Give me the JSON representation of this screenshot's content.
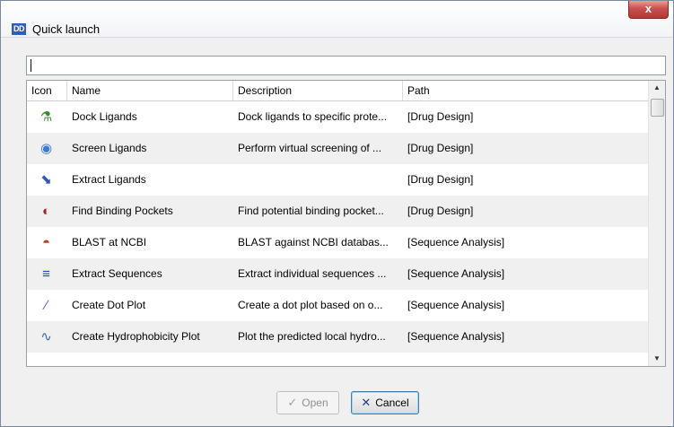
{
  "window": {
    "title": "Quick launch",
    "app_badge": "DD",
    "close_label": "x"
  },
  "search": {
    "value": "",
    "placeholder": ""
  },
  "table": {
    "headers": {
      "icon": "Icon",
      "name": "Name",
      "description": "Description",
      "path": "Path"
    },
    "rows": [
      {
        "icon": "dock-ligands-icon",
        "glyph": "⚗",
        "color": "#3a8a2a",
        "name": "Dock Ligands",
        "description": "Dock ligands to specific prote...",
        "path": "[Drug Design]"
      },
      {
        "icon": "screen-ligands-icon",
        "glyph": "◉",
        "color": "#3a7ad0",
        "name": "Screen Ligands",
        "description": "Perform virtual screening of ...",
        "path": "[Drug Design]"
      },
      {
        "icon": "extract-ligands-icon",
        "glyph": "⬊",
        "color": "#2d56b8",
        "name": "Extract Ligands",
        "description": "",
        "path": "[Drug Design]"
      },
      {
        "icon": "binding-pockets-icon",
        "glyph": "◐",
        "color": "#a0282e",
        "name": "Find Binding Pockets",
        "description": "Find potential binding pocket...",
        "path": "[Drug Design]"
      },
      {
        "icon": "blast-icon",
        "glyph": "◓",
        "color": "#c0392b",
        "name": "BLAST at NCBI",
        "description": "BLAST against NCBI databas...",
        "path": "[Sequence Analysis]"
      },
      {
        "icon": "extract-sequences-icon",
        "glyph": "≡",
        "color": "#1f4fa8",
        "name": "Extract Sequences",
        "description": "Extract individual sequences ...",
        "path": "[Sequence Analysis]"
      },
      {
        "icon": "dot-plot-icon",
        "glyph": "∕",
        "color": "#5060c8",
        "name": "Create Dot Plot",
        "description": "Create a dot plot based on o...",
        "path": "[Sequence Analysis]"
      },
      {
        "icon": "hydrophobicity-plot-icon",
        "glyph": "∿",
        "color": "#2c6cb0",
        "name": "Create Hydrophobicity Plot",
        "description": "Plot the predicted local hydro...",
        "path": "[Sequence Analysis]"
      }
    ]
  },
  "buttons": {
    "open_label": "Open",
    "cancel_label": "Cancel"
  }
}
